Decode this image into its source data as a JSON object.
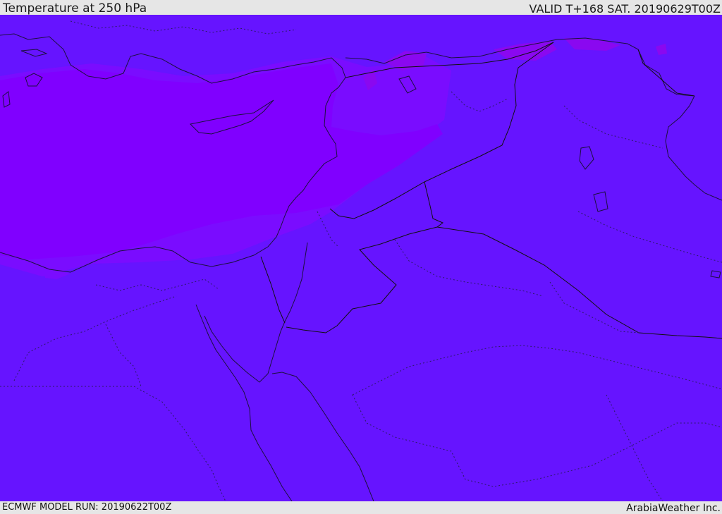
{
  "header": {
    "title": "Temperature at 250 hPa",
    "valid": "VALID T+168 SAT. 20190629T00Z"
  },
  "footer": {
    "model_run": "ECMWF MODEL RUN: 20190622T00Z",
    "credit": "ArabiaWeather Inc."
  },
  "colors": {
    "background_band": "#6614ff",
    "warm_region": "#8000ff",
    "transition_region": "#7a0cff",
    "pink_patches": "#8a08f0",
    "header_background": "#e6e6e6"
  }
}
